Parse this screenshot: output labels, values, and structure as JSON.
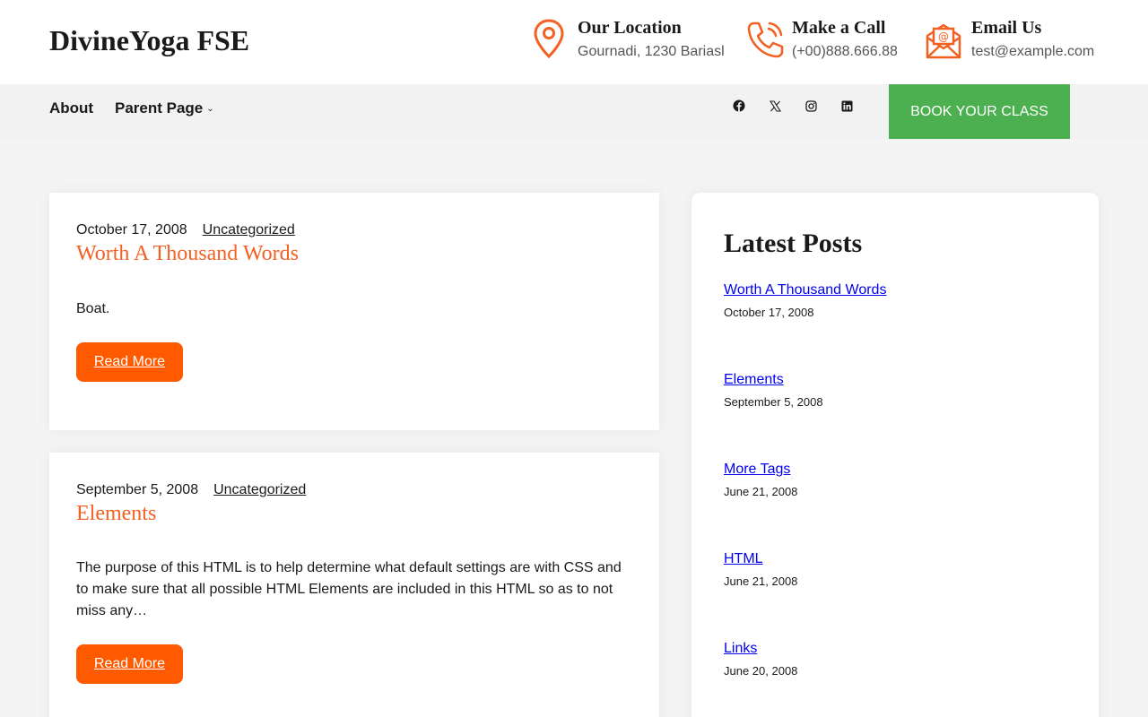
{
  "header": {
    "site_title": "DivineYoga FSE",
    "contacts": [
      {
        "title": "Our Location",
        "text": "Gournadi, 1230 Bariasl",
        "icon": "location-pin-icon"
      },
      {
        "title": "Make a Call",
        "text": "(+00)888.666.88",
        "icon": "phone-icon"
      },
      {
        "title": "Email Us",
        "text": "test@example.com",
        "icon": "email-envelope-icon"
      }
    ],
    "accent_color": "#f26122"
  },
  "nav": {
    "items": [
      {
        "label": "About"
      },
      {
        "label": "Parent Page",
        "has_dropdown": true
      }
    ],
    "social": [
      "facebook-icon",
      "x-twitter-icon",
      "instagram-icon",
      "linkedin-icon"
    ],
    "cta_label": "BOOK YOUR CLASS",
    "cta_color": "#4caf50"
  },
  "posts": [
    {
      "date": "October 17, 2008",
      "category": "Uncategorized",
      "title": "Worth A Thousand Words",
      "excerpt": "Boat.",
      "read_more": "Read More"
    },
    {
      "date": "September 5, 2008",
      "category": "Uncategorized",
      "title": "Elements",
      "excerpt": "The purpose of this HTML is to help determine what default settings are with CSS and to make sure that all possible HTML Elements are included in this HTML so as to not miss any…",
      "read_more": "Read More"
    }
  ],
  "sidebar": {
    "title": "Latest Posts",
    "items": [
      {
        "title": "Worth A Thousand Words",
        "date": "October 17, 2008"
      },
      {
        "title": "Elements",
        "date": "September 5, 2008"
      },
      {
        "title": "More Tags",
        "date": "June 21, 2008"
      },
      {
        "title": "HTML",
        "date": "June 21, 2008"
      },
      {
        "title": "Links",
        "date": "June 20, 2008"
      }
    ]
  },
  "colors": {
    "read_more_button": "#ff5a00",
    "link": "#0000ee"
  }
}
